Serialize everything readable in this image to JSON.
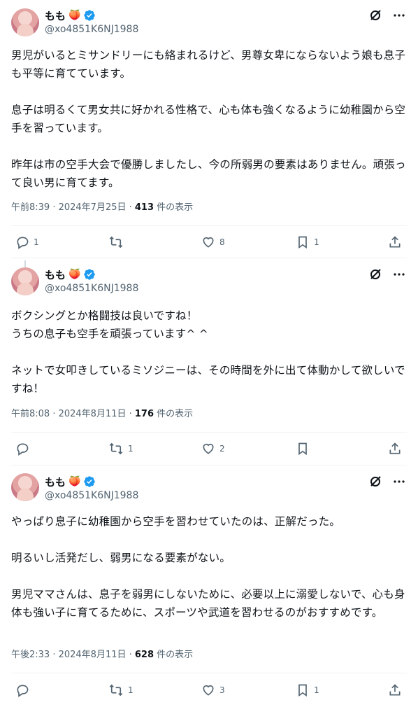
{
  "colors": {
    "text": "#0f1419",
    "secondary": "#536471",
    "verified": "#1d9bf0",
    "divider": "#eff3f4"
  },
  "posts": [
    {
      "author": {
        "name": "もも",
        "emoji": "🍑",
        "handle": "@xo4851K6NJ1988"
      },
      "text": "男児がいるとミサンドリーにも絡まれるけど、男尊女卑にならないよう娘も息子も平等に育てています。\n\n息子は明るくて男女共に好かれる性格で、心も体も強くなるように幼稚園から空手を習っています。\n\n昨年は市の空手大会で優勝しましたし、今の所弱男の要素はありません。頑張って良い男に育てます。",
      "meta_prefix": "午前8:39 · 2024年7月25日 · ",
      "views": "413",
      "views_suffix": " 件の表示",
      "replies": "1",
      "retweets": "",
      "likes": "8",
      "bookmarks": "1"
    },
    {
      "author": {
        "name": "もも",
        "emoji": "🍑",
        "handle": "@xo4851K6NJ1988"
      },
      "text": "ボクシングとか格闘技は良いですね！\nうちの息子も空手を頑張っています^ ^\n\nネットで女叩きしているミソジニーは、その時間を外に出て体動かして欲しいですね！",
      "meta_prefix": "午前8:08 · 2024年8月11日 · ",
      "views": "176",
      "views_suffix": " 件の表示",
      "replies": "",
      "retweets": "1",
      "likes": "2",
      "bookmarks": ""
    },
    {
      "author": {
        "name": "もも",
        "emoji": "🍑",
        "handle": "@xo4851K6NJ1988"
      },
      "text": "やっぱり息子に幼稚園から空手を習わせていたのは、正解だった。\n\n明るいし活発だし、弱男になる要素がない。\n\n男児ママさんは、息子を弱男にしないために、必要以上に溺愛しないで、心も身体も強い子に育てるために、スポーツや武道を習わせるのがおすすめです。",
      "meta_prefix": "午後2:33 · 2024年8月11日 · ",
      "views": "628",
      "views_suffix": " 件の表示",
      "replies": "",
      "retweets": "1",
      "likes": "3",
      "bookmarks": "1"
    }
  ]
}
